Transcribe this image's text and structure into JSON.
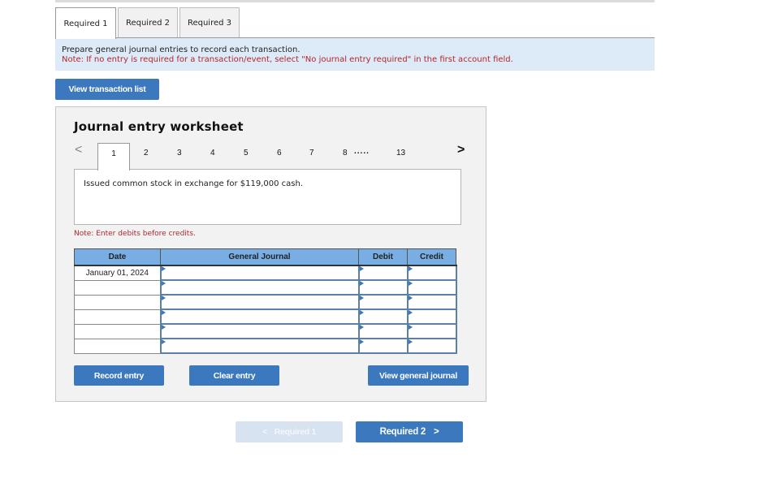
{
  "tabs": [
    {
      "label": "Required 1",
      "active": true
    },
    {
      "label": "Required 2",
      "active": false
    },
    {
      "label": "Required 3",
      "active": false
    }
  ],
  "instructions": {
    "line1": "Prepare general journal entries to record each transaction.",
    "line2": "Note: If no entry is required for a transaction/event, select \"No journal entry required\" in the first account field."
  },
  "view_transaction_list_label": "View transaction list",
  "worksheet": {
    "title": "Journal entry worksheet",
    "pager": {
      "prev_icon": "chevron-left-icon",
      "next_icon": "chevron-right-icon",
      "pages": [
        "1",
        "2",
        "3",
        "4",
        "5",
        "6",
        "7",
        "8"
      ],
      "ellipsis": ".....",
      "last": "13",
      "active_page": "1"
    },
    "transaction_description": "Issued common stock in exchange for $119,000 cash.",
    "note": "Note: Enter debits before credits.",
    "table": {
      "headers": {
        "date": "Date",
        "general_journal": "General Journal",
        "debit": "Debit",
        "credit": "Credit"
      },
      "rows": [
        {
          "date": "January 01, 2024",
          "account": "",
          "debit": "",
          "credit": ""
        },
        {
          "date": "",
          "account": "",
          "debit": "",
          "credit": ""
        },
        {
          "date": "",
          "account": "",
          "debit": "",
          "credit": ""
        },
        {
          "date": "",
          "account": "",
          "debit": "",
          "credit": ""
        },
        {
          "date": "",
          "account": "",
          "debit": "",
          "credit": ""
        },
        {
          "date": "",
          "account": "",
          "debit": "",
          "credit": ""
        }
      ]
    },
    "buttons": {
      "record": "Record entry",
      "clear": "Clear entry",
      "view_journal": "View general journal"
    }
  },
  "nav": {
    "prev_label": "Required 1",
    "prev_icon": "chevron-left-icon",
    "next_label": "Required 2",
    "next_icon": "chevron-right-icon"
  },
  "colors": {
    "primary_button": "#3b78bd",
    "disabled_button": "#d7e3f1",
    "header_blue": "#78aee3",
    "instruction_bg": "#dcebf7",
    "note_red": "#b3262d"
  }
}
